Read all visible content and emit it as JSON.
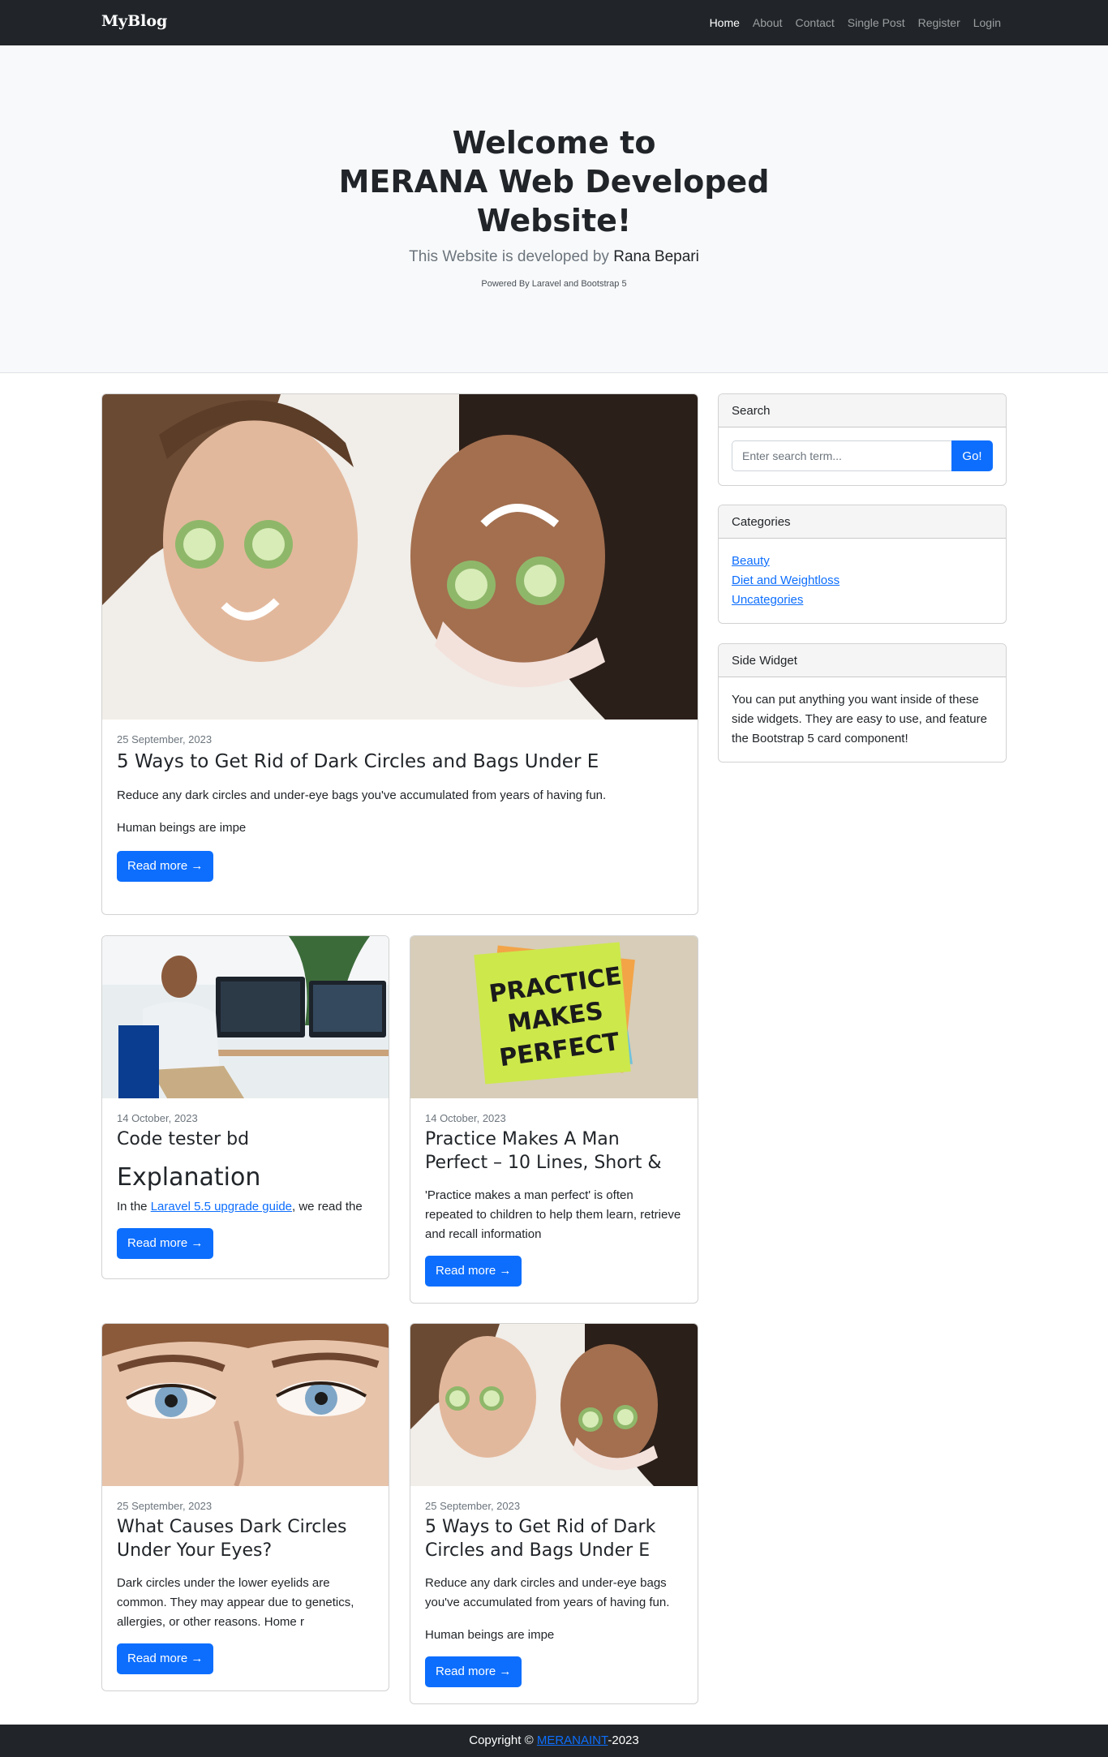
{
  "navbar": {
    "brand": "MyBlog",
    "links": [
      {
        "label": "Home"
      },
      {
        "label": "About"
      },
      {
        "label": "Contact"
      },
      {
        "label": "Single Post"
      },
      {
        "label": "Register"
      },
      {
        "label": "Login"
      }
    ]
  },
  "hero": {
    "title_lines": [
      "Welcome to",
      "MERANA Web Developed",
      "Website!"
    ],
    "lead_prefix": "This Website is developed by ",
    "lead_author": "Rana Bepari",
    "small": "Powered By Laravel and Bootstrap 5"
  },
  "featured": {
    "date": "25 September, 2023",
    "title": "5 Ways to Get Rid of Dark Circles and Bags Under E",
    "paragraph1": "Reduce any dark circles and under-eye bags you've accumulated from years of having fun.",
    "paragraph2": "Human beings are impe",
    "button": "Read more →"
  },
  "posts": [
    {
      "date": "14 October, 2023",
      "title": "Code tester bd",
      "subheading": "Explanation",
      "text_prefix": "In the ",
      "text_link": "Laravel 5.5 upgrade guide",
      "text_suffix": ", we read the",
      "button": "Read more →"
    },
    {
      "date": "14 October, 2023",
      "title": "Practice Makes A Man Perfect – 10 Lines, Short &",
      "text": "'Practice makes a man perfect' is often repeated to children to help them learn, retrieve and recall information",
      "button": "Read more →",
      "image_text": [
        "PRACTICE",
        "MAKES",
        "PERFECT"
      ]
    },
    {
      "date": "25 September, 2023",
      "title": "What Causes Dark Circles Under Your Eyes?",
      "text": "Dark circles under the lower eyelids are common. They may appear due to genetics, allergies, or other reasons. Home r",
      "button": "Read more →"
    },
    {
      "date": "25 September, 2023",
      "title": "5 Ways to Get Rid of Dark Circles and Bags Under E",
      "text": "Reduce any dark circles and under-eye bags you've accumulated from years of having fun.",
      "text2": "Human beings are impe",
      "button": "Read more →"
    }
  ],
  "sidebar": {
    "search": {
      "header": "Search",
      "placeholder": "Enter search term...",
      "button": "Go!"
    },
    "categories": {
      "header": "Categories",
      "items": [
        "Beauty",
        "Diet and Weightloss",
        "Uncategories"
      ]
    },
    "side_widget": {
      "header": "Side Widget",
      "text": "You can put anything you want inside of these side widgets. They are easy to use, and feature the Bootstrap 5 card component!"
    }
  },
  "footer": {
    "prefix": "Copyright © ",
    "link": "MERANAINT",
    "suffix": "-2023"
  },
  "colors": {
    "navbar_bg": "#212529",
    "primary": "#0d6efd",
    "hero_bg": "#f8f9fa"
  }
}
